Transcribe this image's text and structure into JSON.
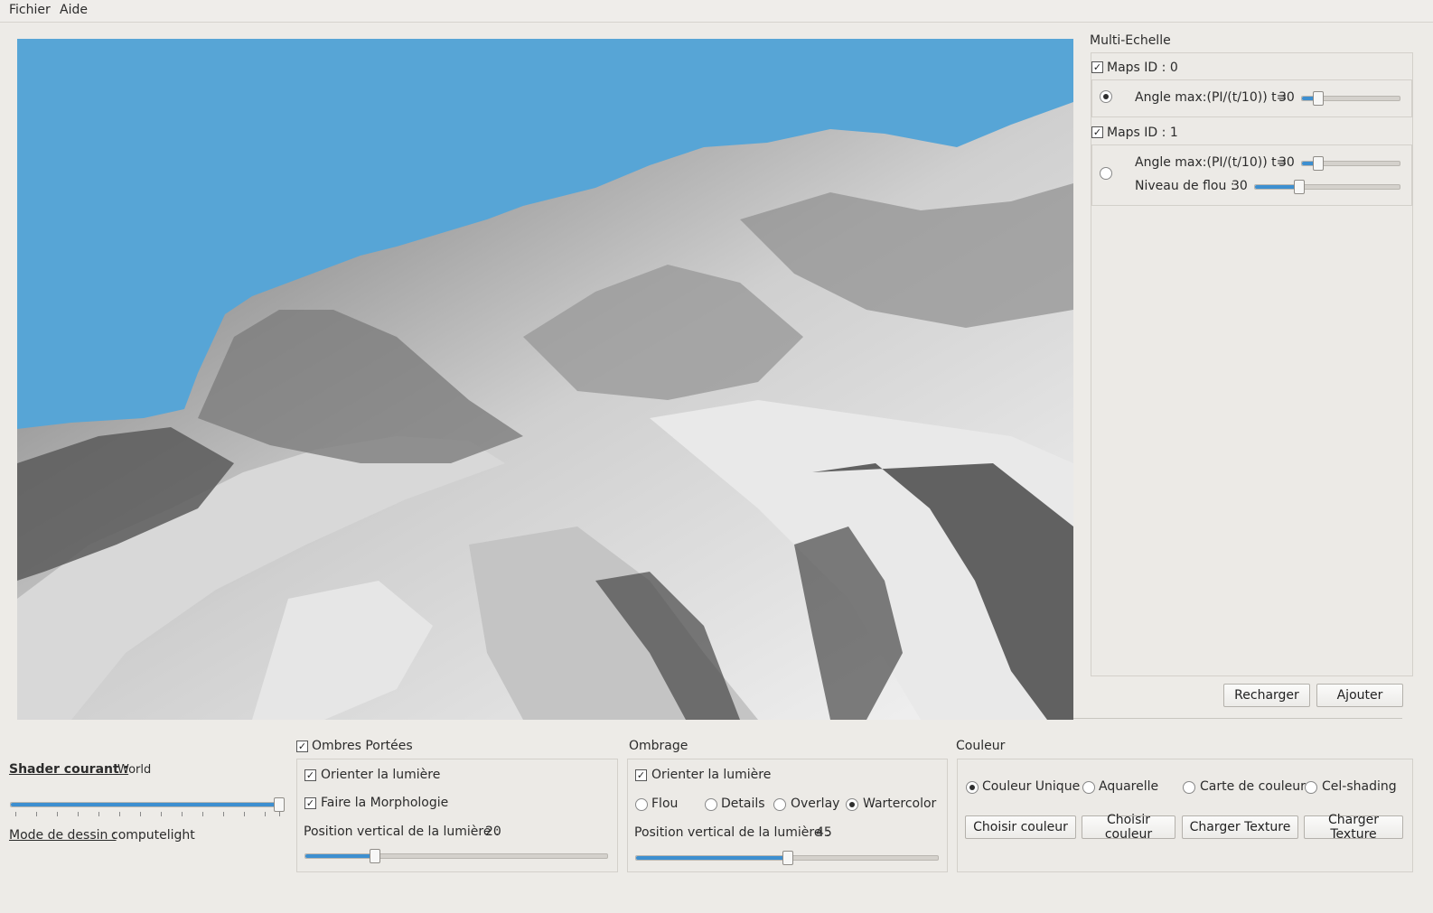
{
  "menu": {
    "file": "Fichier",
    "help": "Aide"
  },
  "multiscale": {
    "title": "Multi-Echelle",
    "maps": [
      {
        "label": "Maps ID : 0",
        "checked": true,
        "radio_selected": true,
        "angle_label": "Angle max:(PI/(t/10)) t=",
        "angle_value": "30"
      },
      {
        "label": "Maps ID : 1",
        "checked": true,
        "radio_selected": false,
        "angle_label": "Angle max:(PI/(t/10)) t=",
        "angle_value": "30",
        "blur_label": "Niveau de flou :",
        "blur_value": "30"
      }
    ],
    "reload_button": "Recharger",
    "add_button": "Ajouter"
  },
  "shader": {
    "current_label": "Shader courant :",
    "current_value": "World",
    "draw_mode_label": "Mode de dessin :",
    "draw_mode_value": "computelight",
    "slider_level": 1.0
  },
  "shadows": {
    "title": "Ombres Portées",
    "checked": true,
    "orient_light": "Orienter la lumière",
    "morphology": "Faire la Morphologie",
    "position_label": "Position vertical de la lumière :",
    "position_value": "20"
  },
  "shading": {
    "title": "Ombrage",
    "orient_light": "Orienter la lumière",
    "modes": [
      "Flou",
      "Details",
      "Overlay",
      "Wartercolor"
    ],
    "selected_mode": "Wartercolor",
    "position_label": "Position vertical de la lumière :",
    "position_value": "45"
  },
  "color": {
    "title": "Couleur",
    "modes": [
      "Couleur Unique",
      "Aquarelle",
      "Carte de couleur",
      "Cel-shading"
    ],
    "selected_mode": "Couleur Unique",
    "buttons": [
      "Choisir couleur",
      "Choisir couleur",
      "Charger Texture",
      "Charger Texture"
    ]
  },
  "colors": {
    "sky": "#57a5d6",
    "accent": "#3d8fd0"
  }
}
